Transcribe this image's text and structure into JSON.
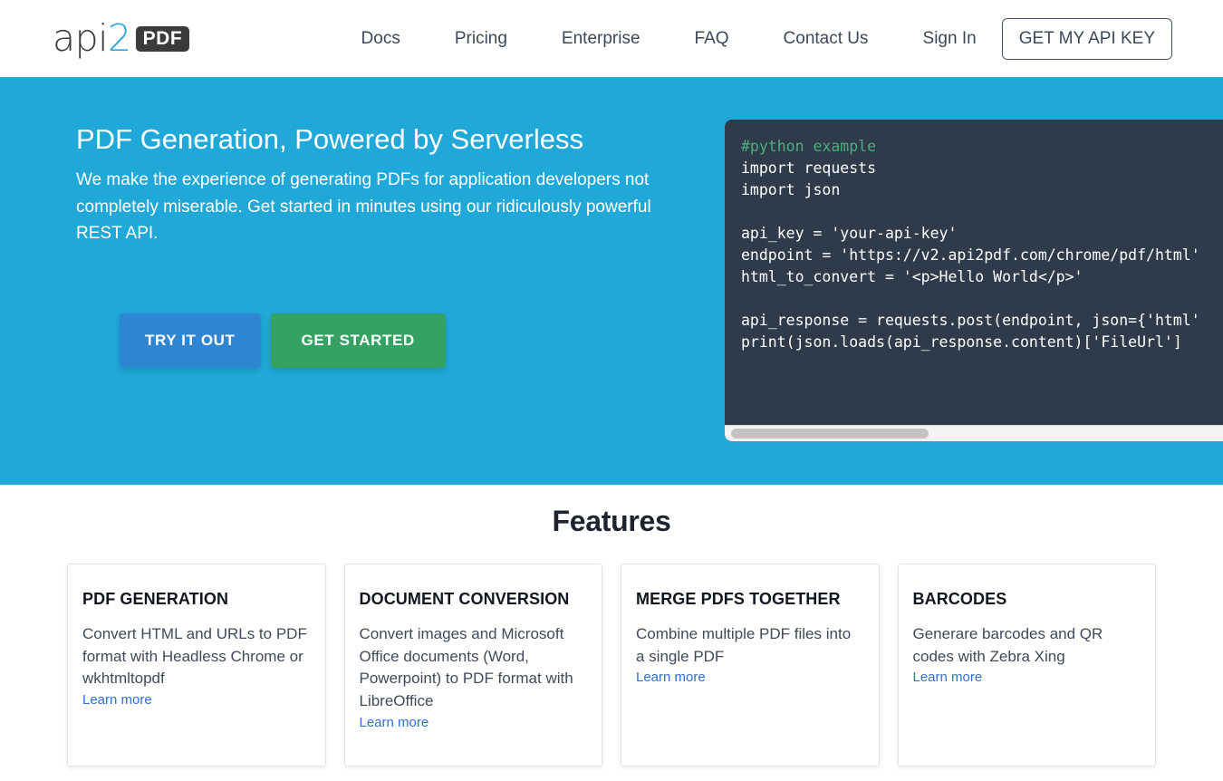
{
  "header": {
    "logo": {
      "api": "api",
      "two": "2",
      "pdf": "PDF"
    },
    "nav": [
      {
        "label": "Docs",
        "name": "nav-link-docs"
      },
      {
        "label": "Pricing",
        "name": "nav-link-pricing"
      },
      {
        "label": "Enterprise",
        "name": "nav-link-enterprise"
      },
      {
        "label": "FAQ",
        "name": "nav-link-faq"
      },
      {
        "label": "Contact Us",
        "name": "nav-link-contact-us"
      },
      {
        "label": "Sign In",
        "name": "nav-link-sign-in"
      }
    ],
    "cta_label": "GET MY API KEY"
  },
  "hero": {
    "title": "PDF Generation, Powered by Serverless",
    "subtitle": "We make the experience of generating PDFs for application developers not completely miserable. Get started in minutes using our ridiculously powerful REST API.",
    "buttons": {
      "try_label": "TRY IT OUT",
      "started_label": "GET STARTED"
    },
    "code": {
      "comment": "#python example",
      "body": "import requests\nimport json\n\napi_key = 'your-api-key'\nendpoint = 'https://v2.api2pdf.com/chrome/pdf/html'\nhtml_to_convert = '<p>Hello World</p>'\n\napi_response = requests.post(endpoint, json={'html'\nprint(json.loads(api_response.content)['FileUrl']"
    }
  },
  "features": {
    "title": "Features",
    "cards": [
      {
        "title": "PDF GENERATION",
        "body": "Convert HTML and URLs to PDF format with Headless Chrome or wkhtmltopdf",
        "link": "Learn more"
      },
      {
        "title": "DOCUMENT CONVERSION",
        "body": "Convert images and Microsoft Office documents (Word, Powerpoint) to PDF format with LibreOffice",
        "link": "Learn more"
      },
      {
        "title": "MERGE PDFS TOGETHER",
        "body": "Combine multiple PDF files into a single PDF",
        "link": "Learn more"
      },
      {
        "title": "BARCODES",
        "body": "Generare barcodes and QR codes with Zebra Xing",
        "link": "Learn more"
      }
    ]
  },
  "colors": {
    "hero_background": "#20a8d8",
    "accent_blue": "#29a8df",
    "try_button": "#2e86d2",
    "started_button": "#35a264",
    "code_background": "#2f3a4b",
    "code_comment": "#4caf7d",
    "nav_text": "#3c4858",
    "link": "#2f6fd0"
  }
}
